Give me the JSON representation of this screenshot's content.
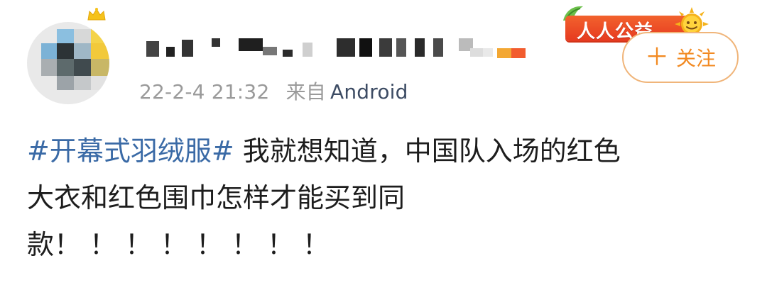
{
  "post": {
    "timestamp": "22-2-4 21:32",
    "source_label": "来自",
    "source_name": "Android",
    "follow_label": "关注",
    "follow_plus": "＋",
    "badge_text": "人人公益",
    "hashtag": "#开幕式羽绒服#",
    "body_line1": " 我就想知道，中国队入场的红色",
    "body_line2": "大衣和红色围巾怎样才能买到同",
    "body_line3_text": "款",
    "body_line3_exclaims": "！！！！！！！！"
  },
  "colors": {
    "link": "#3a6aa6",
    "follow_text": "#f28a22",
    "follow_border": "#f0b57a",
    "meta_gray": "#9a9a9a",
    "badge_red": "#e63a20"
  },
  "icons": {
    "crown": "crown-icon",
    "sun": "sun-icon",
    "plus": "plus-icon"
  }
}
